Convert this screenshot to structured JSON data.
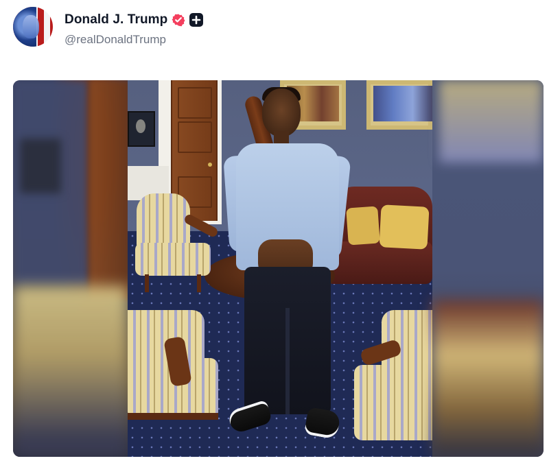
{
  "post": {
    "author": {
      "display_name": "Donald J. Trump",
      "handle": "@realDonaldTrump",
      "avatar_icon": "flag-portrait-avatar",
      "verified_icon": "verified-badge-icon",
      "verified_color": "#f43f5e",
      "extra_badge_icon": "plus-badge-icon",
      "extra_badge_color": "#111827"
    },
    "media": {
      "type": "photo"
    }
  },
  "colors": {
    "text_primary": "#111827",
    "text_secondary": "#6b7280",
    "background": "#ffffff"
  }
}
